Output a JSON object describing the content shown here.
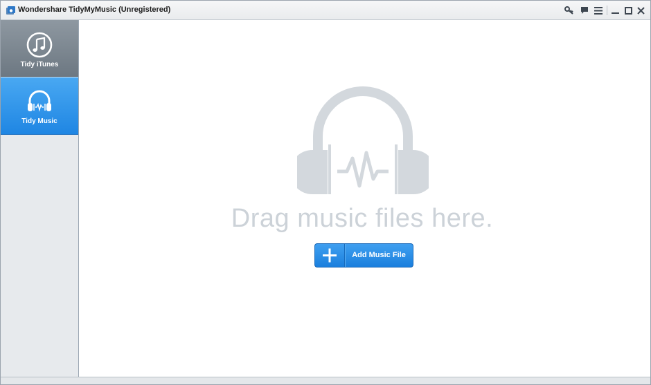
{
  "window": {
    "title": "Wondershare TidyMyMusic (Unregistered)",
    "title_icon": "app-logo-icon",
    "controls": [
      {
        "name": "register-key-icon"
      },
      {
        "name": "feedback-icon"
      },
      {
        "name": "menu-icon"
      },
      {
        "name": "minimize-icon"
      },
      {
        "name": "maximize-icon"
      },
      {
        "name": "close-icon"
      }
    ]
  },
  "sidebar": {
    "items": [
      {
        "label": "Tidy iTunes",
        "icon": "music-note-icon",
        "selected": false
      },
      {
        "label": "Tidy Music",
        "icon": "headphones-icon",
        "selected": true
      }
    ]
  },
  "main": {
    "drop_hint": "Drag music files here.",
    "illustration": "headphones-waveform-icon",
    "add_button": {
      "label": "Add Music File",
      "icon": "plus-icon"
    }
  },
  "colors": {
    "accent": "#1f86e3",
    "sidebar_bg": "#e7eaed",
    "inactive_nav": "#7b858f",
    "hint_text": "#ccd2d8"
  }
}
